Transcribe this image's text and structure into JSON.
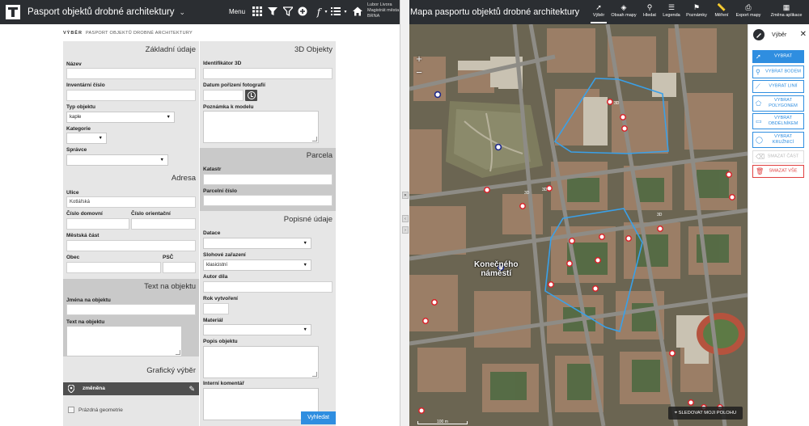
{
  "left_app": {
    "title": "Pasport objektů drobné architektury",
    "menu_label": "Menu",
    "user": {
      "name": "Lubor Livora",
      "org_line1": "Magistrát města",
      "org_line2": "BRNA"
    },
    "toolbar_icons": [
      "grid-icon",
      "filter-icon",
      "filter-clear-icon",
      "add-icon",
      "function-icon",
      "list-view-icon",
      "home-icon"
    ]
  },
  "breadcrumb": {
    "section": "VÝBĚR",
    "sub": "PASPORT OBJEKTŮ DROBNÉ ARCHITEKTURY"
  },
  "sections": {
    "basic": "Základní údaje",
    "address": "Adresa",
    "text": "Text na objektu",
    "graphic": "Grafický výběr",
    "objects3d": "3D Objekty",
    "parcel": "Parcela",
    "descriptive": "Popisné údaje"
  },
  "fields": {
    "nazev": {
      "label": "Název",
      "value": ""
    },
    "inventarni": {
      "label": "Inventární číslo",
      "value": ""
    },
    "typ": {
      "label": "Typ objektu",
      "value": "kaple"
    },
    "kategorie": {
      "label": "Kategorie",
      "value": ""
    },
    "spravce": {
      "label": "Správce",
      "value": ""
    },
    "ulice": {
      "label": "Ulice",
      "value": "Kotlářská"
    },
    "cislo_domovni": {
      "label": "Číslo domovní",
      "value": ""
    },
    "cislo_orientacni": {
      "label": "Číslo orientační",
      "value": ""
    },
    "mestska_cast": {
      "label": "Městská část",
      "value": ""
    },
    "obec": {
      "label": "Obec",
      "value": ""
    },
    "psc": {
      "label": "PSČ",
      "value": ""
    },
    "jmena": {
      "label": "Jména na objektu",
      "value": ""
    },
    "text_na": {
      "label": "Text na objektu",
      "value": ""
    },
    "ident3d": {
      "label": "Identifikátor 3D",
      "value": ""
    },
    "datum_foto": {
      "label": "Datum pořízení fotografií",
      "value": ""
    },
    "poznamka": {
      "label": "Poznámka k modelu",
      "value": ""
    },
    "katastr": {
      "label": "Katastr",
      "value": ""
    },
    "parcelni": {
      "label": "Parcelní číslo",
      "value": ""
    },
    "datace": {
      "label": "Datace",
      "value": ""
    },
    "slohove": {
      "label": "Slohové zařazení",
      "value": "klasicistní"
    },
    "autor": {
      "label": "Autor díla",
      "value": ""
    },
    "rok": {
      "label": "Rok vytvoření",
      "value": ""
    },
    "material": {
      "label": "Materiál",
      "value": ""
    },
    "popis": {
      "label": "Popis objektu",
      "value": ""
    },
    "komentar": {
      "label": "Interní komentář",
      "value": ""
    }
  },
  "graphic": {
    "changed": "změněna",
    "empty": "Prázdná geometrie"
  },
  "search_button": "Vyhledat",
  "map_app": {
    "title": "Mapa pasportu objektů drobné architektury",
    "tools": [
      {
        "label": "Výběr",
        "icon": "cursor-icon"
      },
      {
        "label": "Obsah mapy",
        "icon": "layers-icon"
      },
      {
        "label": "Hledat",
        "icon": "search-icon"
      },
      {
        "label": "Legenda",
        "icon": "legend-icon"
      },
      {
        "label": "Poznámky",
        "icon": "pin-icon"
      },
      {
        "label": "Měření",
        "icon": "ruler-icon"
      },
      {
        "label": "Export mapy",
        "icon": "print-icon"
      },
      {
        "label": "Změna aplikace",
        "icon": "apps-icon"
      }
    ],
    "place_label_line1": "Konečného",
    "place_label_line2": "náměstí",
    "follow_button": "SLEDOVAT MOJI POLOHU",
    "scale": "100 m"
  },
  "side_panel": {
    "title": "Výběr",
    "buttons": [
      {
        "label": "VYBRAT",
        "icon": "cursor-icon",
        "style": "primary"
      },
      {
        "label": "VYBRAT BODEM",
        "icon": "point-icon",
        "style": "normal"
      },
      {
        "label": "VYBRAT LINIÍ",
        "icon": "line-icon",
        "style": "normal"
      },
      {
        "label": "VYBRAT POLYGONEM",
        "icon": "polygon-icon",
        "style": "normal"
      },
      {
        "label": "VYBRAT OBDÉLNÍKEM",
        "icon": "rectangle-icon",
        "style": "normal"
      },
      {
        "label": "VYBRAT KRUŽNICÍ",
        "icon": "circle-icon",
        "style": "normal"
      },
      {
        "label": "SMAZAT ČÁST",
        "icon": "erase-icon",
        "style": "disabled"
      },
      {
        "label": "SMAZAT VŠE",
        "icon": "delete-icon",
        "style": "danger"
      }
    ]
  },
  "colors": {
    "topbar": "#2b2e32",
    "accent": "#2f8ee0",
    "danger": "#e04040",
    "selection_polygon": "#3aa0e8",
    "marker_red": "#d9232a",
    "marker_blue": "#1f2a8a"
  }
}
